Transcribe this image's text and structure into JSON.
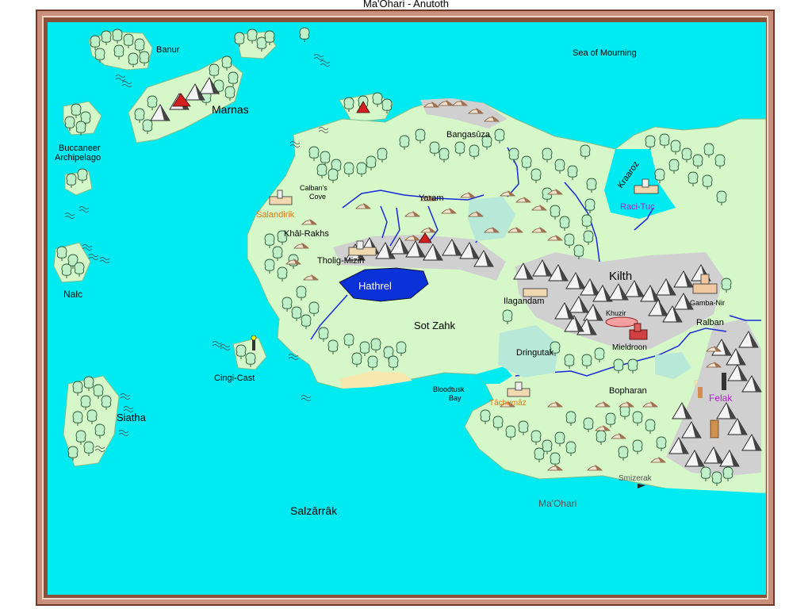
{
  "window": {
    "title": "Ma'Ohari - Anutoth"
  },
  "colors": {
    "sea": "#00eaf2",
    "land": "#d6f7c8",
    "frame": "#c8907a",
    "lake": "#0a32d8",
    "river": "#1a2ad8",
    "mountain": "#d0d0d0",
    "city_orange": "#e07a10",
    "city_purple": "#b020c8",
    "city_blue": "#3030d8",
    "desert": "#f8e8b0"
  },
  "labels": {
    "banur": "Banur",
    "marnas": "Marnas",
    "sea_of_mourning": "Sea of Mourning",
    "buccaneer_1": "Buccaneer",
    "buccaneer_2": "Archipelago",
    "nalc": "Nalc",
    "siatha": "Siatha",
    "cingi_cast": "Cingi-Cast",
    "salzarrak": "Salzârrâk",
    "bangasuza": "Bangasûza",
    "calbans_1": "Calban's",
    "calbans_2": "Cove",
    "yaram": "Yaram",
    "kraaroz": "Kraaroz",
    "raci_tuc": "Raci-Tuc",
    "salandirik": "Salandirik",
    "khal_rakhs": "Khâl-Rakhs",
    "tholig_mizin": "Tholig-Mizin",
    "hathrel": "Hathrel",
    "kilth": "Kilth",
    "ilagandam": "Ilagandam",
    "gamba_nir": "Gamba-Nir",
    "sot_zahk": "Sot Zahk",
    "khuzir": "Khuzir",
    "ralban": "Ralban",
    "mieldroon": "Mieldroon",
    "dringutak": "Dringutak",
    "bloodtusk_1": "Bloodtusk",
    "bloodtusk_2": "Bay",
    "tachumaz": "Tâchumâz",
    "bopharan": "Bopharan",
    "felak": "Felak",
    "smizerak": "Smizerak",
    "maohari": "Ma'Ohari"
  }
}
